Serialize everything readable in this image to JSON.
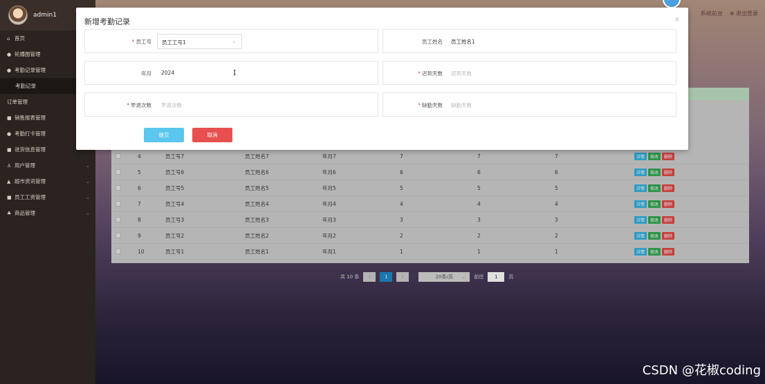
{
  "user": {
    "name": "admin1"
  },
  "sidebar": {
    "items": [
      {
        "icon": "⌂",
        "label": "首页"
      },
      {
        "icon": "●",
        "label": "轮播图管理"
      },
      {
        "icon": "●",
        "label": "考勤记录管理"
      },
      {
        "icon": "",
        "label": "考勤记录",
        "sub": true
      },
      {
        "icon": "",
        "label": "订单管理"
      },
      {
        "icon": "■",
        "label": "销售报表管理"
      },
      {
        "icon": "●",
        "label": "考勤打卡管理"
      },
      {
        "icon": "■",
        "label": "进货信息管理"
      },
      {
        "icon": "♙",
        "label": "用户管理",
        "chev": true
      },
      {
        "icon": "▲",
        "label": "超市资讯管理",
        "chev": true
      },
      {
        "icon": "■",
        "label": "员工工资管理",
        "chev": true
      },
      {
        "icon": "♣",
        "label": "商品管理",
        "chev": true
      }
    ]
  },
  "topnav": {
    "front": "系统前台",
    "logout": "⊗ 退出登录"
  },
  "dialog": {
    "title": "新增考勤记录",
    "close": "×",
    "fields": {
      "emp_no": {
        "label": "员工号",
        "value": "员工工号1",
        "required": "*"
      },
      "emp_name": {
        "label": "员工姓名",
        "value": "员工姓名1"
      },
      "month": {
        "label": "年月",
        "value": "2024"
      },
      "late": {
        "label": "迟到天数",
        "placeholder": "迟到天数",
        "required": "*"
      },
      "early": {
        "label": "早退次数",
        "placeholder": "早退次数",
        "required": "*"
      },
      "absent": {
        "label": "缺勤天数",
        "placeholder": "缺勤天数",
        "required": "*"
      }
    },
    "submit": "提交",
    "cancel": "取消",
    "cursor": "I"
  },
  "table": {
    "rows": [
      {
        "idx": "4",
        "no": "员工号7",
        "name": "员工姓名7",
        "month": "年月7",
        "a": "7",
        "b": "7",
        "c": "7"
      },
      {
        "idx": "5",
        "no": "员工号6",
        "name": "员工姓名6",
        "month": "年月6",
        "a": "6",
        "b": "6",
        "c": "6"
      },
      {
        "idx": "6",
        "no": "员工号5",
        "name": "员工姓名5",
        "month": "年月5",
        "a": "5",
        "b": "5",
        "c": "5"
      },
      {
        "idx": "7",
        "no": "员工号4",
        "name": "员工姓名4",
        "month": "年月4",
        "a": "4",
        "b": "4",
        "c": "4"
      },
      {
        "idx": "8",
        "no": "员工号3",
        "name": "员工姓名3",
        "month": "年月3",
        "a": "3",
        "b": "3",
        "c": "3"
      },
      {
        "idx": "9",
        "no": "员工号2",
        "name": "员工姓名2",
        "month": "年月2",
        "a": "2",
        "b": "2",
        "c": "2"
      },
      {
        "idx": "10",
        "no": "员工号1",
        "name": "员工姓名1",
        "month": "年月1",
        "a": "1",
        "b": "1",
        "c": "1"
      }
    ],
    "actions": {
      "detail": "详情",
      "edit": "修改",
      "delete": "删除"
    }
  },
  "pagination": {
    "total": "共 10 条",
    "prev": "‹",
    "page": "1",
    "next": "›",
    "size": "20条/页",
    "goto": "前往",
    "goto_value": "1",
    "unit": "页"
  },
  "watermark": "CSDN @花椒coding"
}
